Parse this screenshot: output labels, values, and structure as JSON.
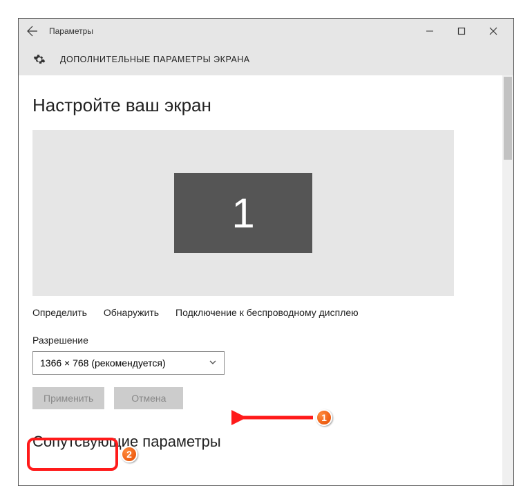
{
  "titlebar": {
    "title": "Параметры"
  },
  "header": {
    "crumb": "ДОПОЛНИТЕЛЬНЫЕ ПАРАМЕТРЫ ЭКРАНА"
  },
  "main": {
    "section_title": "Настройте ваш экран",
    "monitor_number": "1",
    "links": {
      "identify": "Определить",
      "detect": "Обнаружить",
      "wireless": "Подключение к беспроводному дисплею"
    },
    "resolution_label": "Разрешение",
    "resolution_value": "1366 × 768 (рекомендуется)",
    "apply": "Применить",
    "cancel": "Отмена",
    "related_title": "Сопутсвующие параметры"
  },
  "annotations": {
    "step1": "1",
    "step2": "2"
  }
}
